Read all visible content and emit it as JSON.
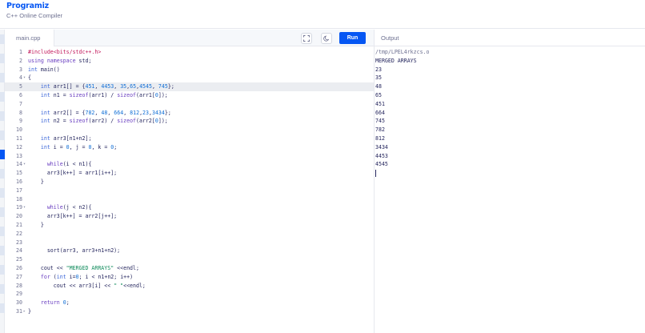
{
  "header": {
    "logo": "Programiz",
    "subtitle": "C++ Online Compiler"
  },
  "toolbar": {
    "file_tab": "main.cpp",
    "run_label": "Run",
    "fullscreen_icon": "fullscreen-icon",
    "theme_icon": "moon-icon"
  },
  "output_panel": {
    "title": "Output",
    "path": "/tmp/LPEL4rkzcs.o",
    "lines": [
      "MERGED ARRAYS",
      "23",
      "35",
      "48",
      "65",
      "451",
      "664",
      "745",
      "782",
      "812",
      "3434",
      "4453",
      "4545"
    ]
  },
  "editor": {
    "highlighted_line": 5,
    "lines": [
      {
        "n": "1",
        "fold": "",
        "html": "<span class=\"inc\">#include&lt;bits/stdc++.h&gt;</span>"
      },
      {
        "n": "2",
        "fold": "",
        "html": "<span class=\"kw\">using namespace</span> std;"
      },
      {
        "n": "3",
        "fold": "",
        "html": "<span class=\"ty\">int</span> main()"
      },
      {
        "n": "4",
        "fold": "▾",
        "html": "{"
      },
      {
        "n": "5",
        "fold": "",
        "html": "    <span class=\"ty\">int</span> arr1[] = {<span class=\"num\">451</span>, <span class=\"num\">4453</span>, <span class=\"num\">35</span>,<span class=\"num\">65</span>,<span class=\"num\">4545</span>, <span class=\"num\">745</span>};"
      },
      {
        "n": "6",
        "fold": "",
        "html": "    <span class=\"ty\">int</span> n1 = <span class=\"kw\">sizeof</span>(arr1) / <span class=\"kw\">sizeof</span>(arr1[<span class=\"num\">0</span>]);"
      },
      {
        "n": "7",
        "fold": "",
        "html": ""
      },
      {
        "n": "8",
        "fold": "",
        "html": "    <span class=\"ty\">int</span> arr2[] = {<span class=\"num\">782</span>, <span class=\"num\">48</span>, <span class=\"num\">664</span>, <span class=\"num\">812</span>,<span class=\"num\">23</span>,<span class=\"num\">3434</span>};"
      },
      {
        "n": "9",
        "fold": "",
        "html": "    <span class=\"ty\">int</span> n2 = <span class=\"kw\">sizeof</span>(arr2) / <span class=\"kw\">sizeof</span>(arr2[<span class=\"num\">0</span>]);"
      },
      {
        "n": "10",
        "fold": "",
        "html": ""
      },
      {
        "n": "11",
        "fold": "",
        "html": "    <span class=\"ty\">int</span> arr3[n1+n2];"
      },
      {
        "n": "12",
        "fold": "",
        "html": "    <span class=\"ty\">int</span> i = <span class=\"num\">0</span>, j = <span class=\"num\">0</span>, k = <span class=\"num\">0</span>;"
      },
      {
        "n": "13",
        "fold": "",
        "html": ""
      },
      {
        "n": "14",
        "fold": "▾",
        "html": "      <span class=\"kw\">while</span>(i &lt; n1){"
      },
      {
        "n": "15",
        "fold": "",
        "html": "      arr3[k++] = arr1[i++];"
      },
      {
        "n": "16",
        "fold": "",
        "html": "    }"
      },
      {
        "n": "17",
        "fold": "",
        "html": ""
      },
      {
        "n": "18",
        "fold": "",
        "html": ""
      },
      {
        "n": "19",
        "fold": "▾",
        "html": "      <span class=\"kw\">while</span>(j &lt; n2){"
      },
      {
        "n": "20",
        "fold": "",
        "html": "      arr3[k++] = arr2[j++];"
      },
      {
        "n": "21",
        "fold": "",
        "html": "    }"
      },
      {
        "n": "22",
        "fold": "",
        "html": ""
      },
      {
        "n": "23",
        "fold": "",
        "html": ""
      },
      {
        "n": "24",
        "fold": "",
        "html": "      sort(arr3, arr3+n1+n2);"
      },
      {
        "n": "25",
        "fold": "",
        "html": ""
      },
      {
        "n": "26",
        "fold": "",
        "html": "    cout &lt;&lt; <span class=\"str\">\"MERGED ARRAYS\"</span> &lt;&lt;endl;"
      },
      {
        "n": "27",
        "fold": "",
        "html": "    <span class=\"kw\">for</span> (<span class=\"ty\">int</span> i=<span class=\"num\">0</span>; i &lt; n1+n2; i++)"
      },
      {
        "n": "28",
        "fold": "",
        "html": "        cout &lt;&lt; arr3[i] &lt;&lt; <span class=\"str\">\" \"</span>&lt;&lt;endl;"
      },
      {
        "n": "29",
        "fold": "",
        "html": ""
      },
      {
        "n": "30",
        "fold": "",
        "html": "    <span class=\"kw\">return</span> <span class=\"num\">0</span>;"
      },
      {
        "n": "31",
        "fold": "▸",
        "html": "}"
      }
    ]
  }
}
